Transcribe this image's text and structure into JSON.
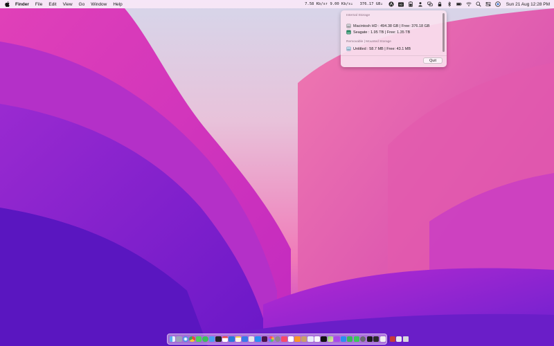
{
  "menubar": {
    "app_name": "Finder",
    "menus": [
      "File",
      "Edit",
      "View",
      "Go",
      "Window",
      "Help"
    ],
    "network_speed": "7.58 Kb/s↑ 9.00 Kb/s↓",
    "storage_status": "376.17 GB↓",
    "clock": "Sun 21 Aug  12:28 PM"
  },
  "popover": {
    "internal_label": "Internal Storage",
    "internal_disks": [
      "Macintosh HD : 494.38 GB | Free: 376.18 GB",
      "Seagate : 1.95 TB | Free: 1.35 TB"
    ],
    "removable_label": "Removable | Mounted Storage",
    "removable_disks": [
      "Untitled : 58.7 MB | Free: 43.1 MB"
    ],
    "quit_label": "Quit"
  },
  "colors": {
    "accent": "#e040a0",
    "wallpaper_light": "#f4c8e0",
    "wallpaper_dark": "#4a1ab0"
  }
}
